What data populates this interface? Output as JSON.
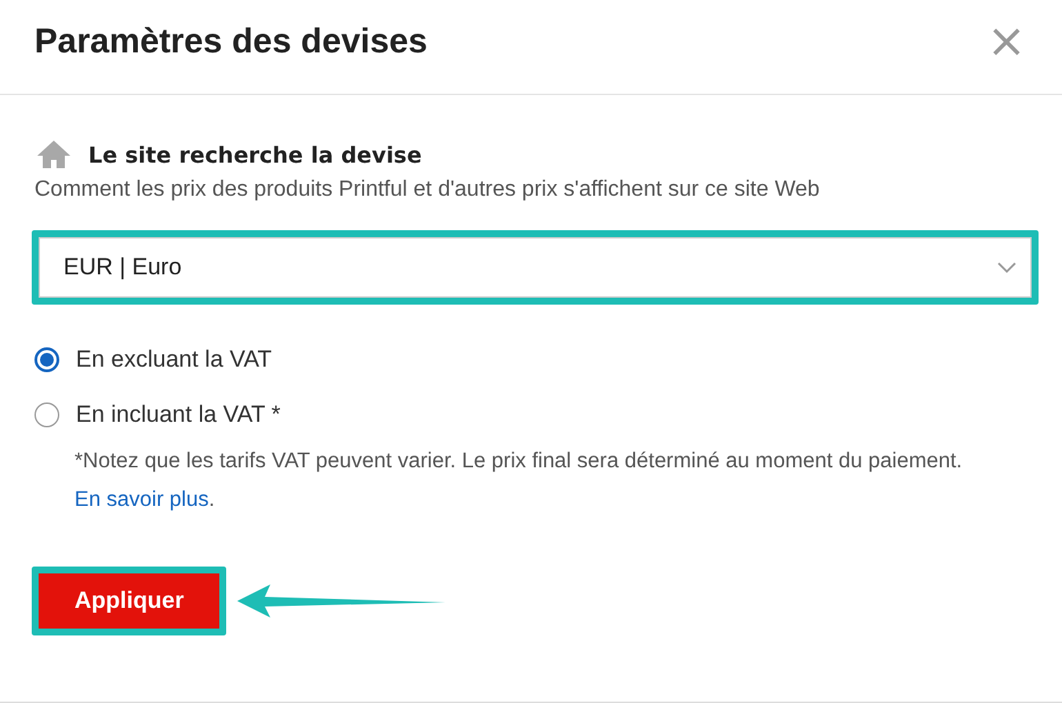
{
  "dialog": {
    "title": "Paramètres des devises",
    "close": "×"
  },
  "section": {
    "heading": "Le site recherche la devise",
    "description": "Comment les prix des produits Printful et d'autres prix s'affichent sur ce site Web"
  },
  "currency_select": {
    "value": "EUR | Euro",
    "highlighted": true
  },
  "vat_options": [
    {
      "label": "En excluant la VAT",
      "selected": true
    },
    {
      "label": "En incluant la VAT *",
      "selected": false
    }
  ],
  "note": {
    "text": "*Notez que les tarifs VAT peuvent varier. Le prix final sera déterminé au moment du paiement.",
    "link": "En savoir plus",
    "after": "."
  },
  "apply_button": {
    "label": "Appliquer",
    "highlighted": true,
    "pointed_by_arrow": true
  }
}
